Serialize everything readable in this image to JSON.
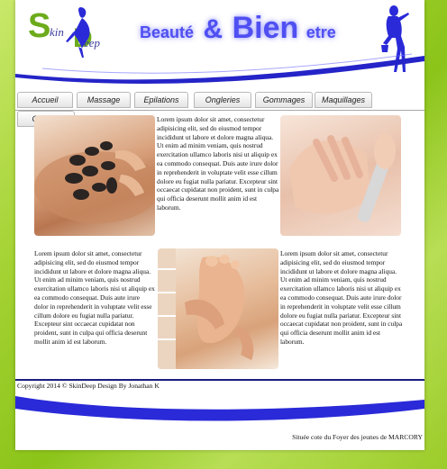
{
  "header": {
    "logo": {
      "s": "S",
      "skin": "kin",
      "d": "D",
      "deep": "eep"
    },
    "title": {
      "part1": "Beauté",
      "part2": "&",
      "part3": "Bien",
      "part4": "etre"
    }
  },
  "nav": {
    "tabs": [
      {
        "label": "Accueil"
      },
      {
        "label": "Massage"
      },
      {
        "label": "Epilations"
      },
      {
        "label": "Ongleries"
      },
      {
        "label": "Gommages"
      },
      {
        "label": "Maquillages"
      },
      {
        "label": "Contact"
      }
    ]
  },
  "content": {
    "lorem": "Lorem ipsum dolor sit amet, consectetur adipisicing elit, sed do eiusmod tempor incididunt ut labore et dolore magna aliqua. Ut enim ad minim veniam, quis nostrud exercitation ullamco laboris nisi ut aliquip ex ea commodo consequat. Duis aute irure dolor in reprehenderit in voluptate velit esse cillum dolore eu fugiat nulla pariatur. Excepteur sint occaecat cupidatat non proident, sunt in culpa qui officia deserunt mollit anim id est laborum."
  },
  "footer": {
    "copyright": "Copyright 2014 © SkinDeep Design By Jonathan K",
    "address": "Située cote du Foyer des jeunes de MARCORY"
  },
  "colors": {
    "accent_blue": "#2a2ad8",
    "logo_green": "#6cab1c",
    "page_bg_green": "#9ccc2a"
  }
}
